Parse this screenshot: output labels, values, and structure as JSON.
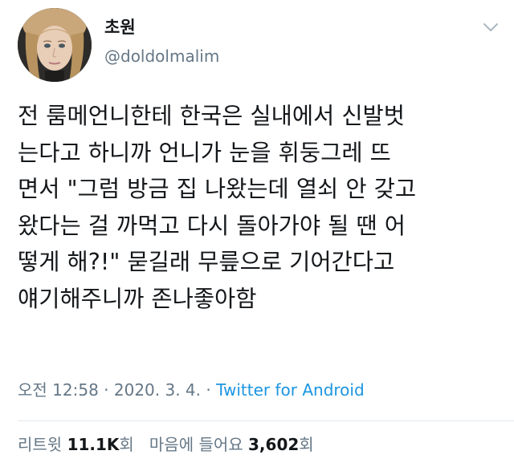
{
  "author": {
    "display_name": "초원",
    "handle": "@doldolmalim"
  },
  "tweet": {
    "text": "전 룸메언니한테 한국은 실내에서 신발벗\n는다고 하니까 언니가 눈을 휘둥그레 뜨\n면서 \"그럼 방금 집 나왔는데 열쇠 안 갖고\n왔다는 걸 까먹고 다시 돌아가야 될 땐 어\n떻게 해?!\" 묻길래 무릎으로 기어간다고\n얘기해주니까 존나좋아함"
  },
  "meta": {
    "time": "오전 12:58",
    "separator1": " · ",
    "date": "2020. 3. 4.",
    "separator2": " · ",
    "source": "Twitter for Android"
  },
  "stats": {
    "retweets_label": "리트윗",
    "retweets_count": "11.1K",
    "retweets_unit": "회",
    "likes_label": "마음에 들어요",
    "likes_count": "3,602",
    "likes_unit": "회"
  },
  "icons": {
    "caret": "chevron-down-icon"
  },
  "colors": {
    "text": "#14171a",
    "secondary": "#657786",
    "link": "#1b95e0",
    "divider": "#e1e8ed"
  }
}
